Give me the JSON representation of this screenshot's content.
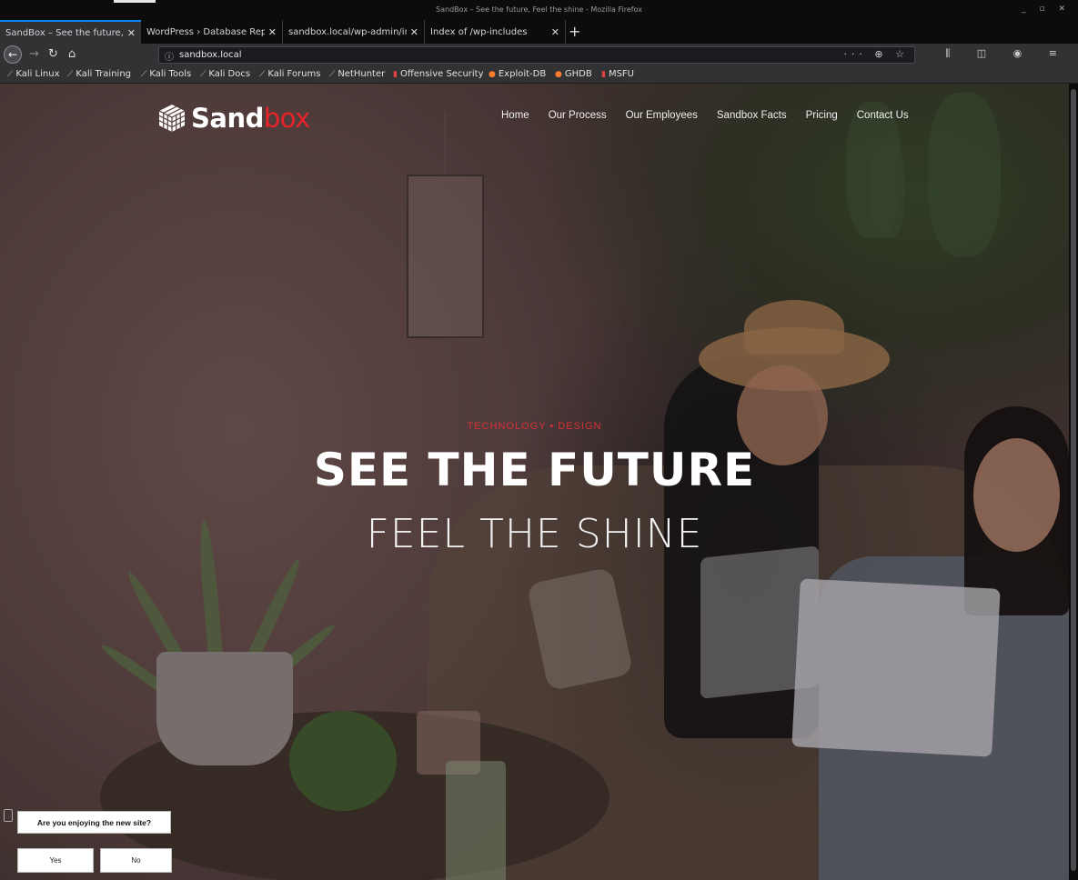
{
  "window": {
    "title": "SandBox – See the future, Feel the shine - Mozilla Firefox",
    "controls": "_ ▫ ✕"
  },
  "tabs": [
    {
      "label": "SandBox – See the future, Fe",
      "active": true
    },
    {
      "label": "WordPress › Database Repa",
      "active": false
    },
    {
      "label": "sandbox.local/wp-admin/inc",
      "active": false
    },
    {
      "label": "Index of /wp-includes",
      "active": false
    }
  ],
  "toolbar": {
    "url": "sandbox.local",
    "page_actions": "··· ⊕ ☆",
    "right_tools": "⫼ ◫ ◉ ≡"
  },
  "bookmarks": [
    {
      "label": "Kali Linux",
      "icon": "kali-dragon-icon"
    },
    {
      "label": "Kali Training",
      "icon": "kali-dragon-icon"
    },
    {
      "label": "Kali Tools",
      "icon": "kali-dragon-icon"
    },
    {
      "label": "Kali Docs",
      "icon": "kali-dragon-icon"
    },
    {
      "label": "Kali Forums",
      "icon": "kali-dragon-icon"
    },
    {
      "label": "NetHunter",
      "icon": "kali-dragon-icon"
    },
    {
      "label": "Offensive Security",
      "icon": "offsec-icon"
    },
    {
      "label": "Exploit-DB",
      "icon": "exploitdb-icon"
    },
    {
      "label": "GHDB",
      "icon": "exploitdb-icon"
    },
    {
      "label": "MSFU",
      "icon": "offsec-icon"
    }
  ],
  "site": {
    "logo_white": "Sand",
    "logo_red": "box",
    "nav": [
      "Home",
      "Our Process",
      "Our Employees",
      "Sandbox Facts",
      "Pricing",
      "Contact Us"
    ],
    "hero": {
      "eyebrow": "TECHNOLOGY • DESIGN",
      "title": "SEE THE FUTURE",
      "subtitle": "FEEL THE SHINE"
    },
    "feedback": {
      "question": "Are you enjoying the new site?",
      "yes": "Yes",
      "no": "No"
    }
  },
  "colors": {
    "accent_red": "#e8232a",
    "firefox_blue": "#0a84ff"
  }
}
